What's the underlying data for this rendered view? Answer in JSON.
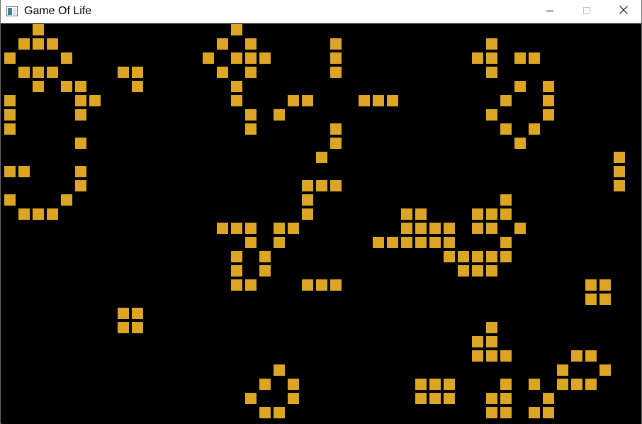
{
  "window": {
    "title": "Game Of Life",
    "icon": "app-window-icon"
  },
  "controls": {
    "minimize_icon": "minimize-icon",
    "maximize_icon": "maximize-icon",
    "maximize_enabled": false,
    "close_icon": "close-icon"
  },
  "board": {
    "background": "#000000",
    "cell_color": "#dca524",
    "columns": 45,
    "rows": 28,
    "live_cells": [
      [
        2,
        0
      ],
      [
        1,
        1
      ],
      [
        2,
        1
      ],
      [
        3,
        1
      ],
      [
        0,
        2
      ],
      [
        4,
        2
      ],
      [
        1,
        3
      ],
      [
        2,
        3
      ],
      [
        3,
        3
      ],
      [
        8,
        3
      ],
      [
        9,
        3
      ],
      [
        2,
        4
      ],
      [
        4,
        4
      ],
      [
        5,
        4
      ],
      [
        9,
        4
      ],
      [
        0,
        5
      ],
      [
        5,
        5
      ],
      [
        6,
        5
      ],
      [
        0,
        6
      ],
      [
        5,
        6
      ],
      [
        0,
        7
      ],
      [
        5,
        8
      ],
      [
        0,
        10
      ],
      [
        1,
        10
      ],
      [
        5,
        10
      ],
      [
        5,
        11
      ],
      [
        0,
        12
      ],
      [
        4,
        12
      ],
      [
        1,
        13
      ],
      [
        2,
        13
      ],
      [
        3,
        13
      ],
      [
        8,
        20
      ],
      [
        9,
        20
      ],
      [
        8,
        21
      ],
      [
        9,
        21
      ],
      [
        16,
        0
      ],
      [
        15,
        1
      ],
      [
        17,
        1
      ],
      [
        14,
        2
      ],
      [
        16,
        2
      ],
      [
        17,
        2
      ],
      [
        18,
        2
      ],
      [
        15,
        3
      ],
      [
        17,
        3
      ],
      [
        16,
        4
      ],
      [
        16,
        5
      ],
      [
        20,
        5
      ],
      [
        21,
        5
      ],
      [
        17,
        6
      ],
      [
        19,
        6
      ],
      [
        17,
        7
      ],
      [
        23,
        1
      ],
      [
        23,
        2
      ],
      [
        23,
        3
      ],
      [
        25,
        5
      ],
      [
        26,
        5
      ],
      [
        27,
        5
      ],
      [
        23,
        7
      ],
      [
        23,
        8
      ],
      [
        22,
        9
      ],
      [
        21,
        11
      ],
      [
        22,
        11
      ],
      [
        23,
        11
      ],
      [
        21,
        12
      ],
      [
        21,
        13
      ],
      [
        15,
        14
      ],
      [
        16,
        14
      ],
      [
        17,
        14
      ],
      [
        19,
        14
      ],
      [
        20,
        14
      ],
      [
        17,
        15
      ],
      [
        19,
        15
      ],
      [
        16,
        16
      ],
      [
        18,
        16
      ],
      [
        16,
        17
      ],
      [
        18,
        17
      ],
      [
        16,
        18
      ],
      [
        17,
        18
      ],
      [
        21,
        18
      ],
      [
        22,
        18
      ],
      [
        23,
        18
      ],
      [
        34,
        1
      ],
      [
        33,
        2
      ],
      [
        34,
        2
      ],
      [
        36,
        2
      ],
      [
        37,
        2
      ],
      [
        34,
        3
      ],
      [
        36,
        4
      ],
      [
        38,
        4
      ],
      [
        35,
        5
      ],
      [
        38,
        5
      ],
      [
        34,
        6
      ],
      [
        38,
        6
      ],
      [
        35,
        7
      ],
      [
        37,
        7
      ],
      [
        36,
        8
      ],
      [
        43,
        9
      ],
      [
        43,
        10
      ],
      [
        43,
        11
      ],
      [
        35,
        12
      ],
      [
        28,
        13
      ],
      [
        29,
        13
      ],
      [
        33,
        13
      ],
      [
        34,
        13
      ],
      [
        35,
        13
      ],
      [
        28,
        14
      ],
      [
        29,
        14
      ],
      [
        30,
        14
      ],
      [
        31,
        14
      ],
      [
        33,
        14
      ],
      [
        34,
        14
      ],
      [
        36,
        14
      ],
      [
        26,
        15
      ],
      [
        27,
        15
      ],
      [
        28,
        15
      ],
      [
        29,
        15
      ],
      [
        30,
        15
      ],
      [
        31,
        15
      ],
      [
        35,
        15
      ],
      [
        31,
        16
      ],
      [
        32,
        16
      ],
      [
        33,
        16
      ],
      [
        34,
        16
      ],
      [
        35,
        16
      ],
      [
        32,
        17
      ],
      [
        33,
        17
      ],
      [
        34,
        17
      ],
      [
        41,
        18
      ],
      [
        42,
        18
      ],
      [
        41,
        19
      ],
      [
        42,
        19
      ],
      [
        34,
        21
      ],
      [
        33,
        22
      ],
      [
        34,
        22
      ],
      [
        33,
        23
      ],
      [
        34,
        23
      ],
      [
        35,
        23
      ],
      [
        40,
        23
      ],
      [
        41,
        23
      ],
      [
        39,
        24
      ],
      [
        42,
        24
      ],
      [
        35,
        25
      ],
      [
        37,
        25
      ],
      [
        39,
        25
      ],
      [
        40,
        25
      ],
      [
        41,
        25
      ],
      [
        34,
        26
      ],
      [
        35,
        26
      ],
      [
        38,
        26
      ],
      [
        34,
        27
      ],
      [
        35,
        27
      ],
      [
        37,
        27
      ],
      [
        38,
        27
      ],
      [
        29,
        25
      ],
      [
        30,
        25
      ],
      [
        31,
        25
      ],
      [
        29,
        26
      ],
      [
        30,
        26
      ],
      [
        31,
        26
      ],
      [
        19,
        24
      ],
      [
        18,
        25
      ],
      [
        20,
        25
      ],
      [
        17,
        26
      ],
      [
        20,
        26
      ],
      [
        18,
        27
      ],
      [
        19,
        27
      ]
    ]
  }
}
